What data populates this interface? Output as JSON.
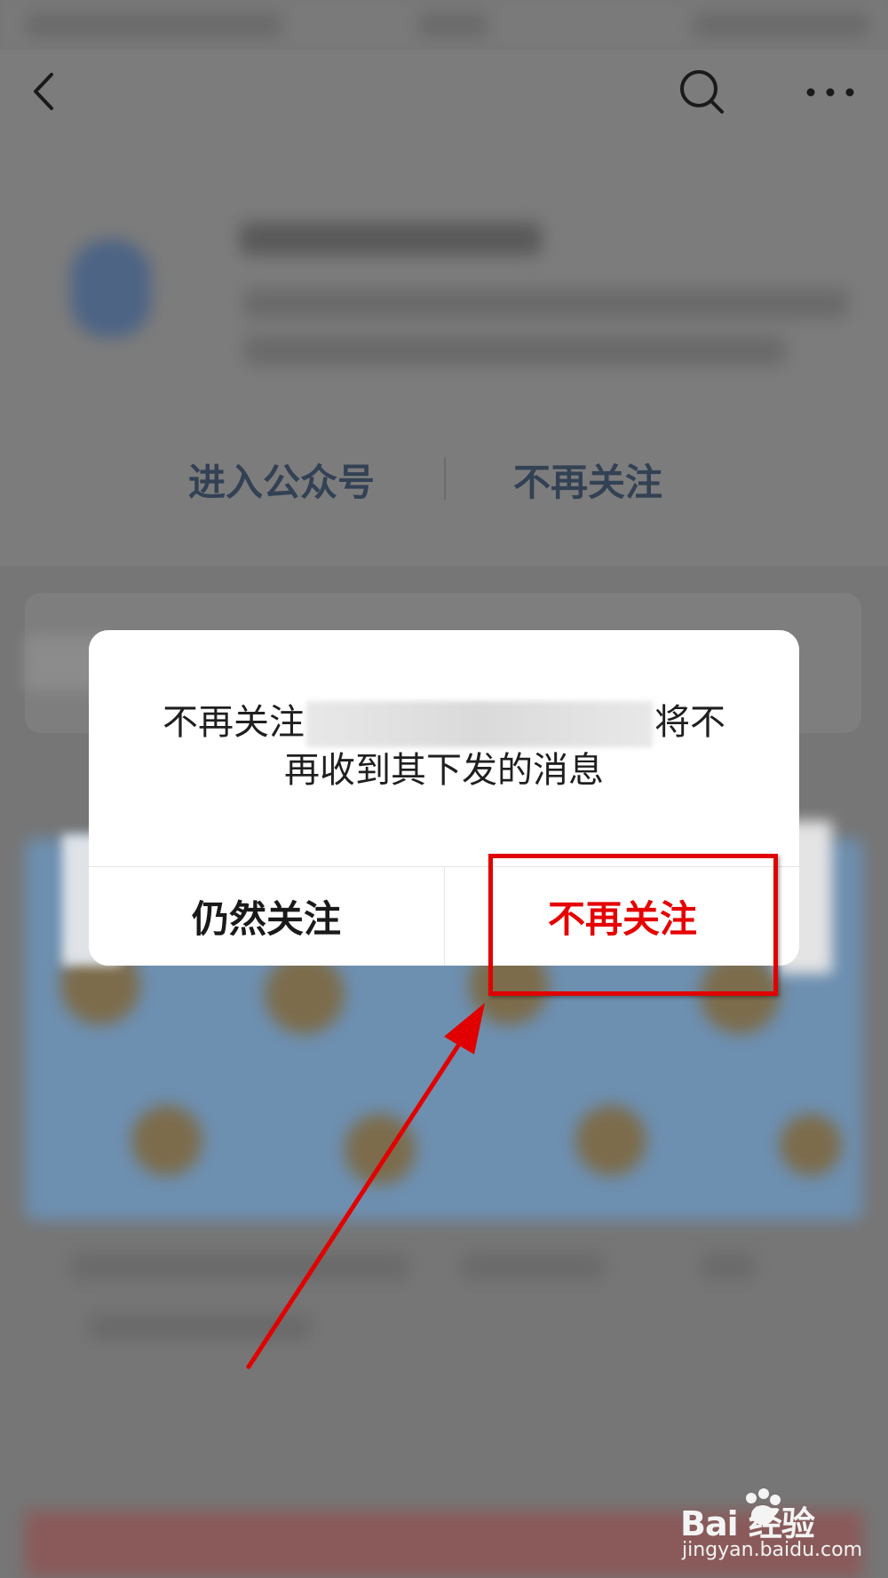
{
  "nav": {
    "back_icon": "chevron-left-icon",
    "search_icon": "search-icon",
    "more_icon": "more-dots-icon"
  },
  "profile": {
    "enter_label": "进入公众号",
    "unfollow_label": "不再关注"
  },
  "dialog": {
    "message_prefix": "不再关注",
    "message_suffix": "将不",
    "message_line2": "再收到其下发的消息",
    "keep_button": "仍然关注",
    "unfollow_button": "不再关注"
  },
  "watermark": {
    "logo": "Bai 经验",
    "url": "jingyan.baidu.com"
  },
  "colors": {
    "overlay": "#767676",
    "accent_red": "#e60000",
    "annotation_red": "#e10000",
    "profile_link": "#334155"
  }
}
